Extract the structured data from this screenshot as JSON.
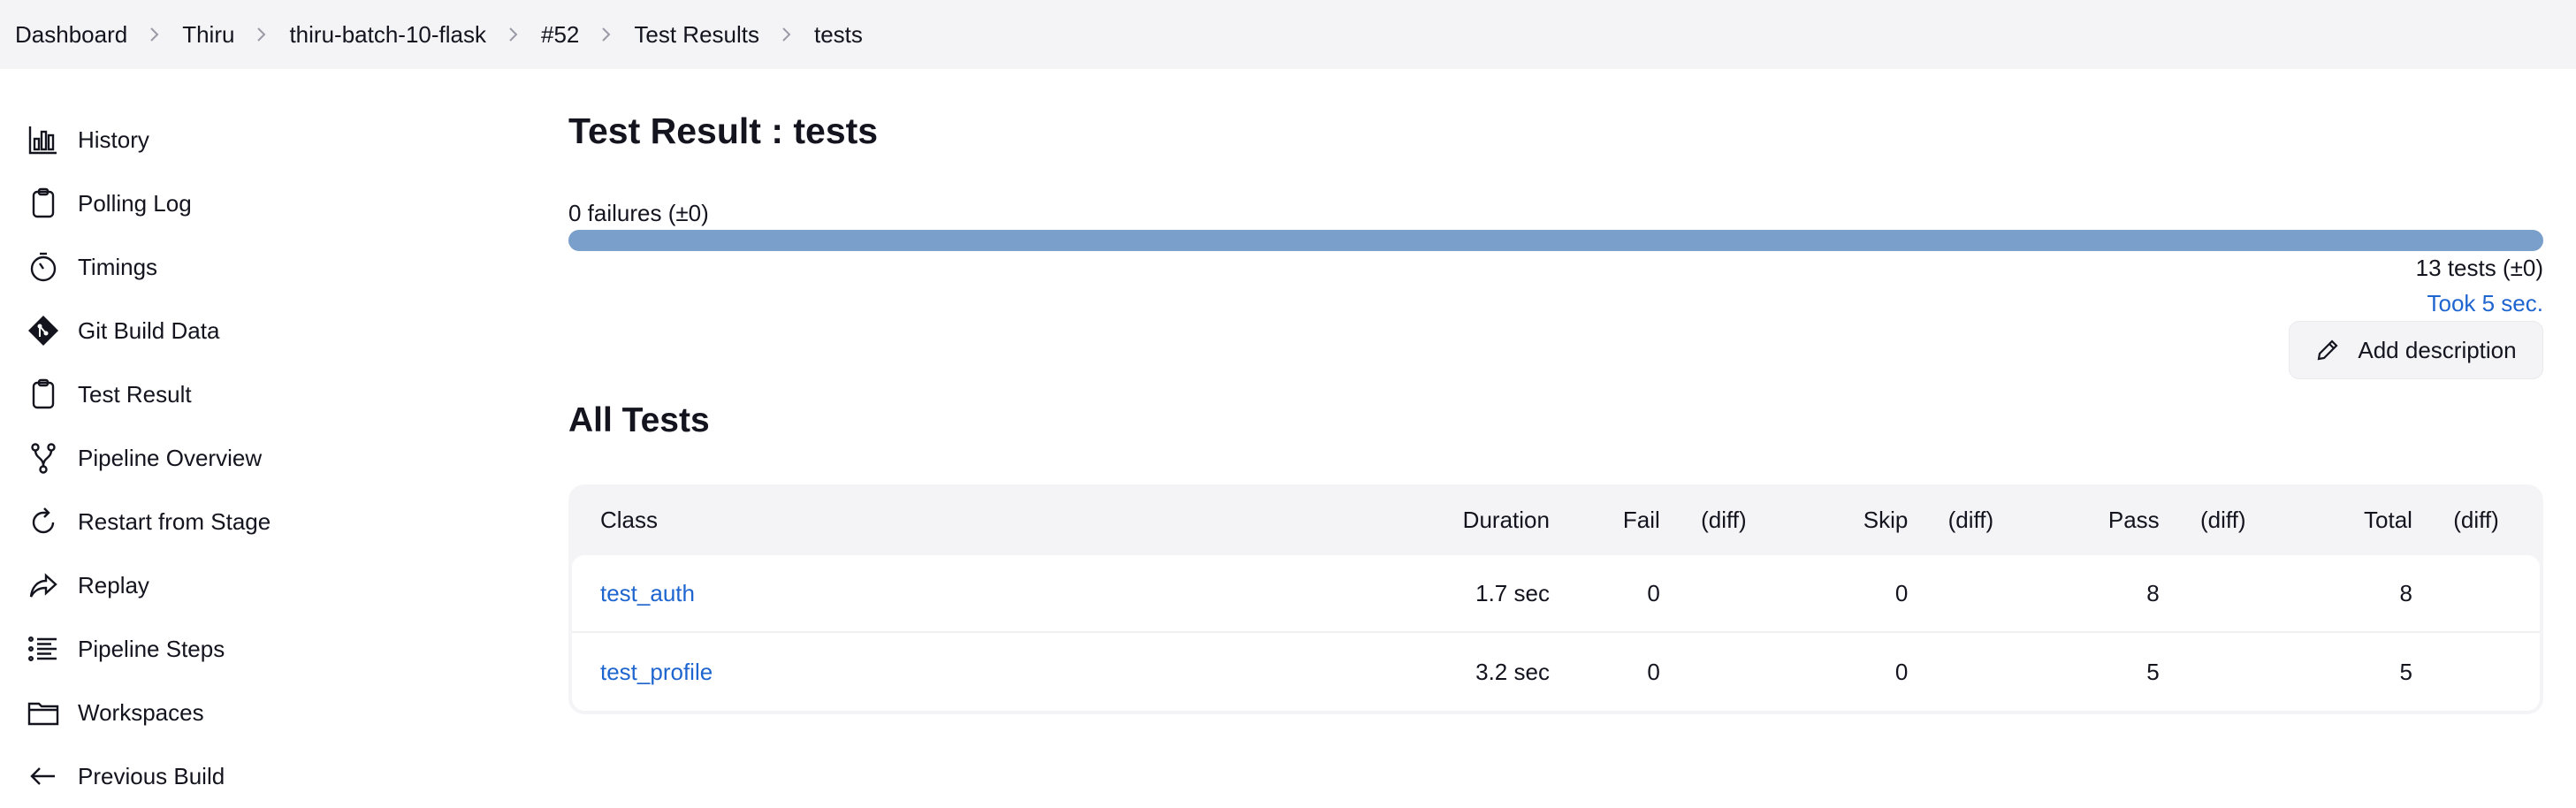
{
  "breadcrumb": {
    "items": [
      "Dashboard",
      "Thiru",
      "thiru-batch-10-flask",
      "#52",
      "Test Results",
      "tests"
    ]
  },
  "sidebar": {
    "items": [
      {
        "label": "History",
        "icon": "bar-chart-icon"
      },
      {
        "label": "Polling Log",
        "icon": "clipboard-icon"
      },
      {
        "label": "Timings",
        "icon": "stopwatch-icon"
      },
      {
        "label": "Git Build Data",
        "icon": "git-icon"
      },
      {
        "label": "Test Result",
        "icon": "clipboard-icon"
      },
      {
        "label": "Pipeline Overview",
        "icon": "branch-icon"
      },
      {
        "label": "Restart from Stage",
        "icon": "restart-icon"
      },
      {
        "label": "Replay",
        "icon": "replay-icon"
      },
      {
        "label": "Pipeline Steps",
        "icon": "list-icon"
      },
      {
        "label": "Workspaces",
        "icon": "folder-icon"
      },
      {
        "label": "Previous Build",
        "icon": "arrow-left-icon"
      }
    ]
  },
  "main": {
    "title": "Test Result : tests",
    "failures_summary": "0 failures (±0)",
    "progress_pass_fraction": 1.0,
    "tests_summary": "13 tests (±0)",
    "took": "Took 5 sec.",
    "add_description": "Add description",
    "section_title": "All Tests"
  },
  "table": {
    "headers": {
      "class": "Class",
      "duration": "Duration",
      "fail": "Fail",
      "fail_diff": "(diff)",
      "skip": "Skip",
      "skip_diff": "(diff)",
      "pass": "Pass",
      "pass_diff": "(diff)",
      "total": "Total",
      "total_diff": "(diff)"
    },
    "rows": [
      {
        "class": "test_auth",
        "duration": "1.7 sec",
        "fail": "0",
        "fail_diff": "",
        "skip": "0",
        "skip_diff": "",
        "pass": "8",
        "pass_diff": "",
        "total": "8",
        "total_diff": ""
      },
      {
        "class": "test_profile",
        "duration": "3.2 sec",
        "fail": "0",
        "fail_diff": "",
        "skip": "0",
        "skip_diff": "",
        "pass": "5",
        "pass_diff": "",
        "total": "5",
        "total_diff": ""
      }
    ]
  },
  "colors": {
    "accent_link": "#1f65d0",
    "progress_pass": "#7a9fcb",
    "header_bg": "#f4f4f6"
  }
}
